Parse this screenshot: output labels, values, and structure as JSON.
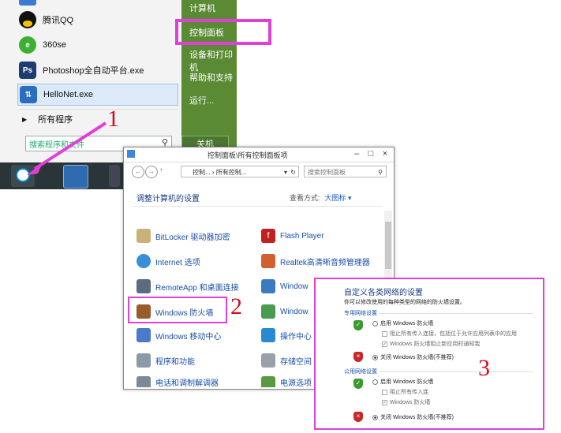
{
  "start_menu": {
    "items": [
      {
        "label": "腾讯QQ",
        "icon": "qq-penguin-icon"
      },
      {
        "label": "360se",
        "icon": "360-browser-icon"
      },
      {
        "label": "Photoshop全自动平台.exe",
        "icon": "photoshop-icon"
      },
      {
        "label": "HelloNet.exe",
        "icon": "hellonet-icon"
      }
    ],
    "all_programs": "所有程序",
    "search_placeholder": "搜索程序和文件",
    "right_items": [
      "计算机",
      "控制面板",
      "设备和打印机",
      "帮助和支持",
      "运行..."
    ],
    "shutdown": "关机"
  },
  "annotations": {
    "n1": "1",
    "n2": "2",
    "n3": "3"
  },
  "control_panel": {
    "window_title": "控制面板\\所有控制面板项",
    "address": "控制... › 所有控制...",
    "search_placeholder": "搜索控制面板",
    "heading": "调整计算机的设置",
    "view_by_label": "查看方式:",
    "view_by_value": "大图标 ▾",
    "items_left": [
      "BitLocker 驱动器加密",
      "Internet 选项",
      "RemoteApp 和桌面连接",
      "Windows 防火墙",
      "Windows 移动中心",
      "程序和功能",
      "电话和调制解调器"
    ],
    "items_right": [
      "Flash Player",
      "Realtek高清晰音频管理器",
      "Window",
      "Window",
      "操作中心",
      "存储空间",
      "电源选项"
    ]
  },
  "firewall": {
    "title": "自定义各类网络的设置",
    "description": "你可以修改使用的每种类型的网络的防火墙设置。",
    "private_header": "专用网络设置",
    "public_header": "公用网络设置",
    "enable": "启用 Windows 防火墙",
    "block_all": "阻止所有传入连接，包括位于允许应用列表中的应用",
    "notify": "Windows 防火墙阻止新应用时通知我",
    "disable": "关闭 Windows 防火墙(不推荐)",
    "block_all_public": "阻止所有传入连",
    "notify_public": "Windows 防火墙",
    "disable_public": "关闭 Windows 防火墙(不推荐)"
  },
  "colors": {
    "highlight": "#e040d8",
    "number": "#d01020",
    "menu_green": "#5a8a34"
  }
}
